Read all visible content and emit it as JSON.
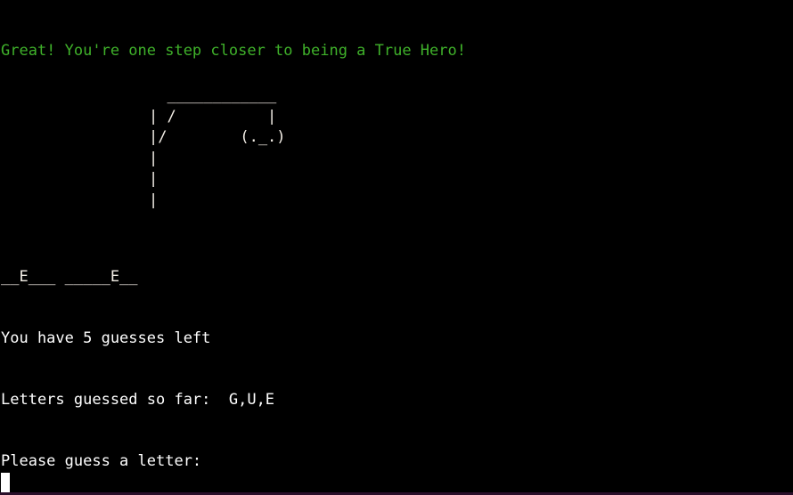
{
  "terminal": {
    "success_message": "Great! You're one step closer to being a True Hero!",
    "hangman_art": {
      "line1": "  ____________",
      "line2": "| /          |",
      "line3": "|/        (._.)",
      "line4": "|",
      "line5": "|",
      "line6": "|"
    },
    "word_display": "__E___ _____E__",
    "guesses_left": "You have 5 guesses left",
    "letters_guessed": "Letters guessed so far:  G,U,E",
    "prompt": "Please guess a letter:"
  },
  "colors": {
    "background": "#000000",
    "text": "#ffffff",
    "success": "#3fb12a"
  }
}
